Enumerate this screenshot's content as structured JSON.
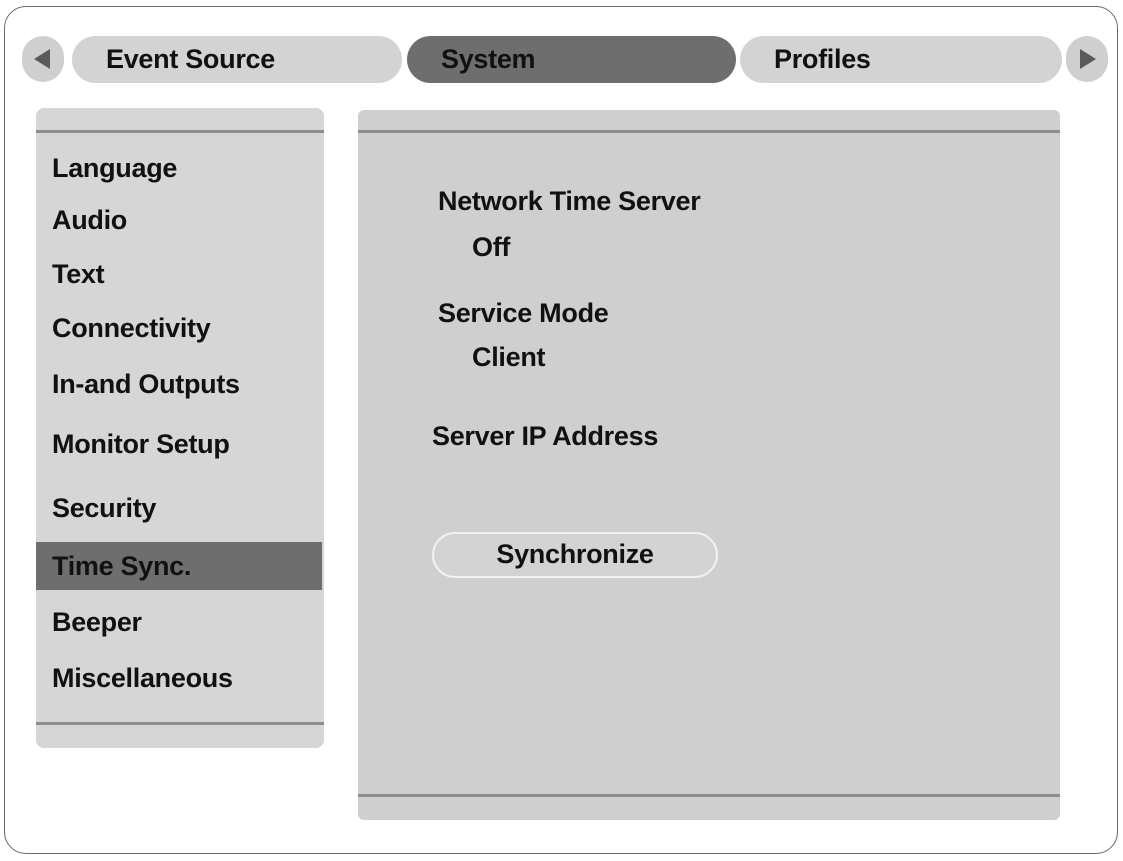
{
  "tabs": {
    "items": [
      {
        "label": "Event Source",
        "selected": false
      },
      {
        "label": "System",
        "selected": true
      },
      {
        "label": "Profiles",
        "selected": false
      }
    ],
    "prev_icon": "triangle-left-icon",
    "next_icon": "triangle-right-icon"
  },
  "menu": {
    "items": [
      {
        "label": "Language"
      },
      {
        "label": "Audio"
      },
      {
        "label": "Text"
      },
      {
        "label": "Connectivity"
      },
      {
        "label": "In-and Outputs"
      },
      {
        "label": "Monitor Setup"
      },
      {
        "label": "Security"
      },
      {
        "label": "Time Sync.",
        "selected": true
      },
      {
        "label": "Beeper"
      },
      {
        "label": "Miscellaneous"
      }
    ]
  },
  "time_sync": {
    "network_time_server_label": "Network Time Server",
    "network_time_server_value": "Off",
    "service_mode_label": "Service Mode",
    "service_mode_value": "Client",
    "server_ip_label": "Server IP Address",
    "synchronize_label": "Synchronize"
  },
  "colors": {
    "selected": "#6e6e6e",
    "panel": "#cfcfcf",
    "tab": "#d3d3d3"
  }
}
